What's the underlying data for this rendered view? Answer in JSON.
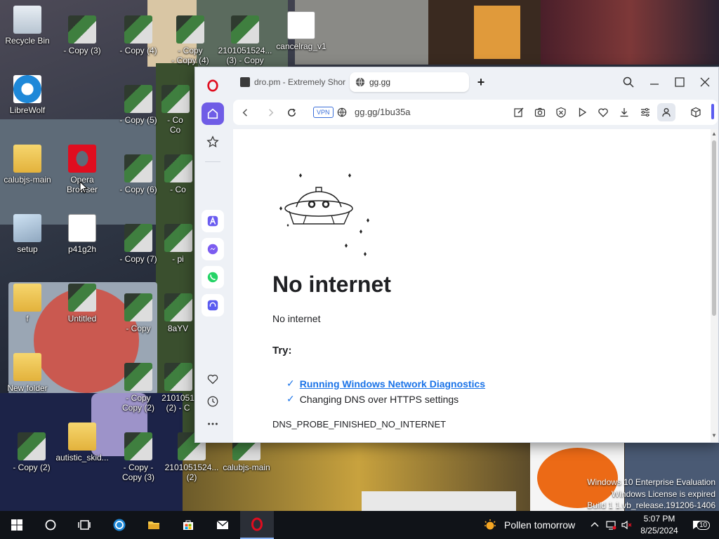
{
  "colors": {
    "opera_red": "#e00d1f",
    "link_blue": "#1a73e8",
    "sidebar_accent": "#6f5ce6",
    "taskbar": "#101318"
  },
  "desktop": {
    "icons": [
      {
        "label": "Recycle Bin",
        "icon": "recycle-bin-icon"
      },
      {
        "label": "- Copy (3)",
        "icon": "image-thumbnail-icon"
      },
      {
        "label": "- Copy (4)",
        "icon": "image-thumbnail-icon"
      },
      {
        "label": "- Copy\n- Copy (4)",
        "icon": "image-thumbnail-icon"
      },
      {
        "label": "2101051524...\n(3) - Copy",
        "icon": "image-thumbnail-icon"
      },
      {
        "label": "cancelrag_v1",
        "icon": "document-icon"
      },
      {
        "label": "LibreWolf",
        "icon": "librewolf-icon"
      },
      {
        "label": "- Copy (5)",
        "icon": "image-thumbnail-icon"
      },
      {
        "label": "- Co\nCo",
        "icon": "image-thumbnail-icon"
      },
      {
        "label": "calubjs-main",
        "icon": "folder-icon"
      },
      {
        "label": "Opera\nBrowser",
        "icon": "opera-icon"
      },
      {
        "label": "- Copy (6)",
        "icon": "image-thumbnail-icon"
      },
      {
        "label": "- Co",
        "icon": "image-thumbnail-icon"
      },
      {
        "label": "setup",
        "icon": "setup-icon"
      },
      {
        "label": "p41g2h",
        "icon": "image-file-icon"
      },
      {
        "label": "- Copy (7)",
        "icon": "image-thumbnail-icon"
      },
      {
        "label": "- pi",
        "icon": "image-thumbnail-icon"
      },
      {
        "label": "f",
        "icon": "folder-icon"
      },
      {
        "label": "Untitled",
        "icon": "image-file-icon"
      },
      {
        "label": "- Copy",
        "icon": "image-thumbnail-icon"
      },
      {
        "label": "8aYV",
        "icon": "image-thumbnail-icon"
      },
      {
        "label": "New folder",
        "icon": "folder-icon"
      },
      {
        "label": "- Copy\nCopy (2)",
        "icon": "image-thumbnail-icon"
      },
      {
        "label": "2101051\n(2) - C",
        "icon": "image-thumbnail-icon"
      },
      {
        "label": "- Copy (2)",
        "icon": "image-thumbnail-icon"
      },
      {
        "label": "autistic_skid...",
        "icon": "folder-icon"
      },
      {
        "label": "- Copy -\nCopy (3)",
        "icon": "image-thumbnail-icon"
      },
      {
        "label": "2101051524...\n(2)",
        "icon": "image-thumbnail-icon"
      },
      {
        "label": "calubjs-main",
        "icon": "image-thumbnail-icon"
      }
    ],
    "watermark": {
      "line1": "Windows 10 Enterprise Evaluation",
      "line2": "Windows License is expired",
      "line3": "Build 1 1.vb_release.191206-1406"
    }
  },
  "browser": {
    "tabs": [
      {
        "title": "dro.pm - Extremely Short",
        "favicon": "dropm-favicon",
        "active": false
      },
      {
        "title": "gg.gg",
        "favicon": "globe-favicon",
        "active": true
      }
    ],
    "new_tab_label": "+",
    "vpn_label": "VPN",
    "url": "gg.gg/1bu35a",
    "sidebar": [
      "opera-logo-icon",
      "home-icon",
      "star-icon",
      "aria-icon",
      "messenger-icon",
      "whatsapp-icon",
      "music-icon",
      "heart-icon",
      "history-icon",
      "more-icon"
    ],
    "toolbar_icons": [
      "edit-icon",
      "camera-icon",
      "adblock-icon",
      "play-icon",
      "heart-icon",
      "download-icon",
      "easy-setup-icon",
      "profile-icon",
      "cube-icon"
    ],
    "page": {
      "title": "No internet",
      "subtitle": "No internet",
      "try_label": "Try:",
      "suggestions": [
        "Running Windows Network Diagnostics",
        "Changing DNS over HTTPS settings"
      ],
      "error_code": "DNS_PROBE_FINISHED_NO_INTERNET"
    }
  },
  "taskbar": {
    "weather_text": "Pollen tomorrow",
    "time": "5:07 PM",
    "date": "8/25/2024",
    "notifications": "10",
    "buttons": [
      "start-icon",
      "search-icon",
      "task-view-icon",
      "librewolf-icon",
      "file-explorer-icon",
      "store-icon",
      "mail-icon",
      "opera-icon"
    ]
  }
}
